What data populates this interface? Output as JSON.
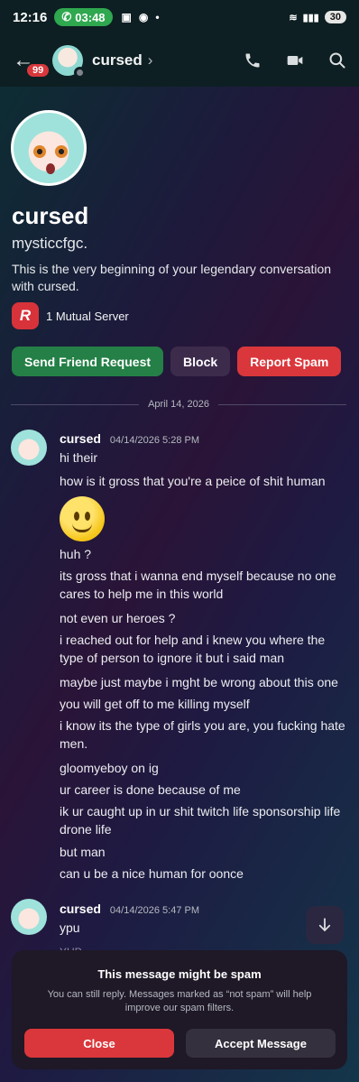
{
  "status_bar": {
    "time": "12:16",
    "call_timer": "03:48",
    "battery": "30"
  },
  "header": {
    "unread_badge": "99",
    "name": "cursed",
    "chevron": "›"
  },
  "profile": {
    "display_name": "cursed",
    "username": "mysticcfgc.",
    "intro": "This is the very beginning of your legendary conversation with cursed.",
    "server_initial": "R",
    "mutual_servers": "1 Mutual Server",
    "buttons": {
      "friend_request": "Send Friend Request",
      "block": "Block",
      "report_spam": "Report Spam"
    }
  },
  "date_divider": "April 14, 2026",
  "messages": [
    {
      "author": "cursed",
      "time": "04/14/2026 5:28 PM",
      "lines": [
        "hi their",
        "how is it gross that you're a peice of shit human",
        "huh ?",
        "its gross that i wanna end myself because no one cares to help me in this world",
        "not even ur heroes ?",
        "i reached out for help and i knew you where the type of person to ignore it but i said man",
        "maybe just maybe i mght be wrong about this one",
        "you will get off to me killing myself",
        "i know its the type of girls you are, you fucking hate men.",
        "gloomyeboy on ig",
        "ur career is done because of me",
        "ik ur caught up in ur shit twitch life sponsorship life drone life",
        "but man",
        "can u be a nice human for oonce"
      ]
    },
    {
      "author": "cursed",
      "time": "04/14/2026 5:47 PM",
      "lines": [
        "ypu",
        "YUP"
      ]
    }
  ],
  "spam_sheet": {
    "title": "This message might be spam",
    "description": "You can still reply. Messages marked as “not spam” will help improve our spam filters.",
    "close_label": "Close",
    "accept_label": "Accept Message"
  },
  "colors": {
    "accent_green": "#248046",
    "accent_red": "#da373c",
    "call_green": "#2fa84f"
  }
}
